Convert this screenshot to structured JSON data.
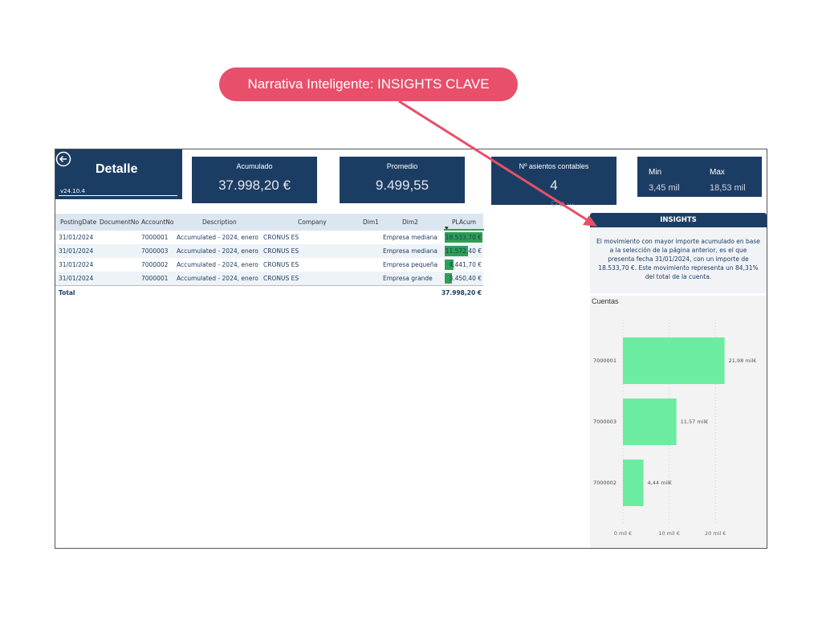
{
  "callout": {
    "text": "Narrativa Inteligente: INSIGHTS CLAVE",
    "color": "#e84f6a"
  },
  "header": {
    "title": "Detalle",
    "version": "v24.10.4"
  },
  "kpis": {
    "acumulado": {
      "label": "Acumulado",
      "value": "37.998,20 €"
    },
    "promedio": {
      "label": "Promedio",
      "value": "9.499,55"
    },
    "asientos": {
      "label": "Nº asientos contables",
      "value": "4"
    },
    "min": {
      "label": "Min",
      "value": "3,45 mil"
    },
    "max": {
      "label": "Max",
      "value": "18,53 mil"
    }
  },
  "table": {
    "columns": [
      "PostingDate",
      "DocumentNo",
      "AccountNo",
      "Description",
      "Company",
      "Dim1",
      "Dim2",
      "PLAcum"
    ],
    "rows": [
      {
        "date": "31/01/2024",
        "doc": "",
        "account": "7000001",
        "desc": "Accumulated - 2024, enero",
        "company": "CRONUS ES",
        "dim1": "",
        "dim2": "Empresa mediana",
        "placum": "18.533,70 €",
        "amount": 18533.7
      },
      {
        "date": "31/01/2024",
        "doc": "",
        "account": "7000003",
        "desc": "Accumulated - 2024, enero",
        "company": "CRONUS ES",
        "dim1": "",
        "dim2": "Empresa mediana",
        "placum": "11.572,40 €",
        "amount": 11572.4
      },
      {
        "date": "31/01/2024",
        "doc": "",
        "account": "7000002",
        "desc": "Accumulated - 2024, enero",
        "company": "CRONUS ES",
        "dim1": "",
        "dim2": "Empresa pequeña",
        "placum": "4.441,70 €",
        "amount": 4441.7
      },
      {
        "date": "31/01/2024",
        "doc": "",
        "account": "7000001",
        "desc": "Accumulated - 2024, enero",
        "company": "CRONUS ES",
        "dim1": "",
        "dim2": "Empresa grande",
        "placum": "3.450,40 €",
        "amount": 3450.4
      }
    ],
    "total_label": "Total",
    "total_value": "37.998,20 €"
  },
  "insights": {
    "title": "INSIGHTS",
    "text": "El movimiento con mayor importe acumulado en base a la selección de la página anterior, es el que presenta fecha 31/01/2024, con un importe de 18.533,70 €. Este movimiento representa un 84,31% del total de la cuenta."
  },
  "chart_data": {
    "type": "bar",
    "orientation": "horizontal",
    "title": "Cuentas",
    "categories": [
      "7000001",
      "7000003",
      "7000002"
    ],
    "values": [
      21.98,
      11.57,
      4.44
    ],
    "data_labels": [
      "21,98 mil€",
      "11,57 mil€",
      "4,44 mil€"
    ],
    "x_ticks": [
      0,
      10,
      20
    ],
    "x_tick_labels": [
      "0 mil €",
      "10 mil €",
      "20 mil €"
    ],
    "xlim": [
      0,
      25
    ],
    "grid": true,
    "bar_color": "#6ceca0"
  },
  "colors": {
    "navy": "#1c3d63",
    "databar": "#2e9e55"
  }
}
